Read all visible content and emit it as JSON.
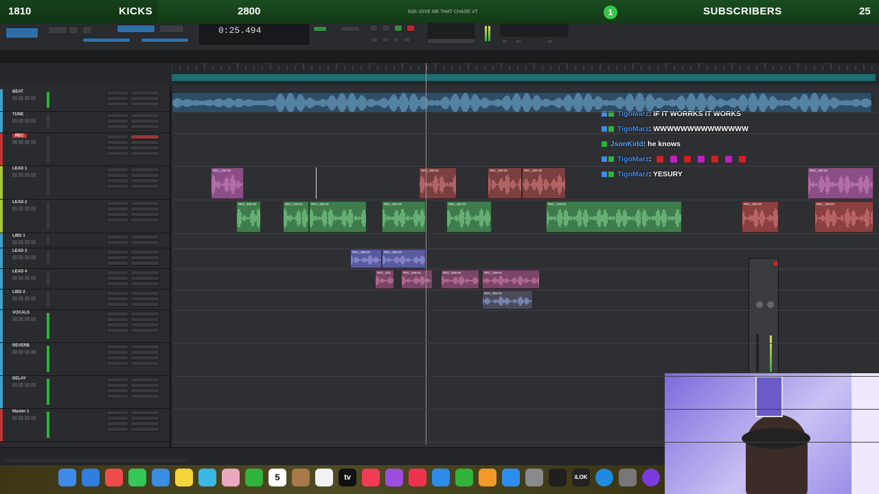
{
  "overlay": {
    "left_count": "1810",
    "left_label": "KICKS",
    "mid_count": "2800",
    "badge": "1",
    "right_label": "SUBSCRIBERS",
    "right_count": "25"
  },
  "window": {
    "title": "Edit: GIVE ME THAT CHASE VT"
  },
  "transport": {
    "counter": "0:25.494",
    "colors": {
      "accent_green": "#2fb33a",
      "accent_blue": "#2e6fa8",
      "record_red": "#b82a2a"
    }
  },
  "tracks": [
    {
      "name": "BEAT",
      "color": "#3fa0c8"
    },
    {
      "name": "TUNE",
      "color": "#3fa0c8"
    },
    {
      "name": "REC",
      "color": "#c13434",
      "record": true
    },
    {
      "name": "LEAD 1",
      "color": "#a6c83a"
    },
    {
      "name": "LEAD 2",
      "color": "#a6c83a"
    },
    {
      "name": "LIBS 1",
      "color": "#3fa0c8"
    },
    {
      "name": "LEAD 3",
      "color": "#3fa0c8"
    },
    {
      "name": "LEAD 4",
      "color": "#3fa0c8"
    },
    {
      "name": "LIBS 2",
      "color": "#3fa0c8"
    },
    {
      "name": "VOCALS",
      "color": "#3fa0c8"
    },
    {
      "name": "REVERB",
      "color": "#3fa0c8"
    },
    {
      "name": "DELAY",
      "color": "#3fa0c8"
    },
    {
      "name": "Master 1",
      "color": "#c13434"
    }
  ],
  "regions": {
    "lead1": [
      "REC_144-02",
      "REC_283-04",
      "REC_306-01",
      "REC_282-06",
      "REC_182-02"
    ],
    "lead2": [
      "REC_232-02",
      "REC_233-04",
      "REC_400-01",
      "REC_301-01",
      "REC_397-01",
      "REC_123-04",
      "REC_183-02",
      "REC_183-03"
    ],
    "lead3": [
      "REC_306-02",
      "REC_269-02"
    ],
    "lead4": [
      "REC_203",
      "REC_406-01",
      "REC_309-06",
      "REC_335-01"
    ],
    "libs2": [
      "REC_303-01"
    ]
  },
  "chat": [
    {
      "user": "TigoMarz",
      "message": ": IF IT WORRKS IT WORKS"
    },
    {
      "user": "TigoMarz",
      "message": ": WWWWWWWWWWWWWW"
    },
    {
      "user": "JsonKidd",
      "message": ": he knows"
    },
    {
      "user": "TigoMarz",
      "message": ":"
    },
    {
      "user": "TigoMarz",
      "message": ": YESURY"
    }
  ],
  "dock": {
    "calendar_day": "5",
    "tv_label": "tv",
    "ilok_label": "iLOK"
  }
}
